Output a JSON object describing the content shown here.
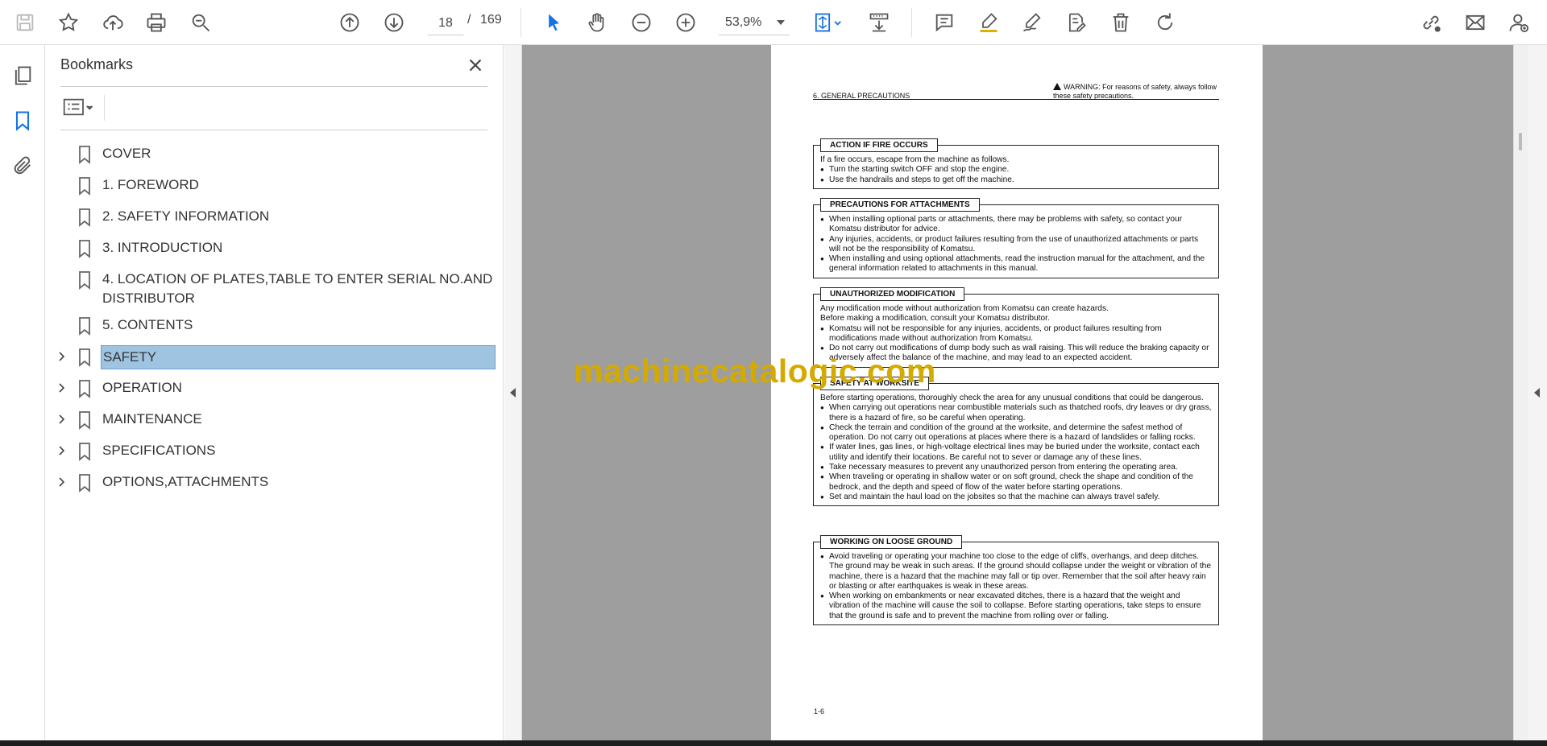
{
  "toolbar": {
    "page_current": "18",
    "page_separator": "/",
    "page_total": "169",
    "zoom": "53,9%",
    "icons": [
      "save-icon",
      "star-icon",
      "cloud-upload-icon",
      "print-icon",
      "zoom-search-icon",
      "page-up-icon",
      "page-down-icon",
      "select-cursor-icon",
      "hand-icon",
      "zoom-out-icon",
      "zoom-in-icon",
      "fit-page-icon",
      "scroll-mode-icon",
      "comment-icon",
      "highlight-icon",
      "sign-icon",
      "edit-text-icon",
      "delete-icon",
      "rotate-icon",
      "share-link-icon",
      "mail-icon",
      "account-icon"
    ]
  },
  "rail": {
    "icons": [
      "pages-icon",
      "bookmark-icon",
      "attachment-icon"
    ]
  },
  "bookmarks": {
    "title": "Bookmarks",
    "items": [
      {
        "label": "COVER",
        "expandable": false,
        "selected": false
      },
      {
        "label": "1. FOREWORD",
        "expandable": false,
        "selected": false
      },
      {
        "label": "2. SAFETY INFORMATION",
        "expandable": false,
        "selected": false
      },
      {
        "label": "3. INTRODUCTION",
        "expandable": false,
        "selected": false
      },
      {
        "label": "4. LOCATION OF PLATES,TABLE TO ENTER SERIAL NO.AND DISTRIBUTOR",
        "expandable": false,
        "selected": false
      },
      {
        "label": "5. CONTENTS",
        "expandable": false,
        "selected": false
      },
      {
        "label": "SAFETY",
        "expandable": true,
        "selected": true
      },
      {
        "label": "OPERATION",
        "expandable": true,
        "selected": false
      },
      {
        "label": "MAINTENANCE",
        "expandable": true,
        "selected": false
      },
      {
        "label": "SPECIFICATIONS",
        "expandable": true,
        "selected": false
      },
      {
        "label": "OPTIONS,ATTACHMENTS",
        "expandable": true,
        "selected": false
      }
    ]
  },
  "document": {
    "header_left": "6.  GENERAL PRECAUTIONS",
    "header_right": "WARNING: For reasons of safety, always follow these safety precautions.",
    "page_number": "1-6",
    "watermark": "machinecatalogic.com",
    "sections": [
      {
        "title": "ACTION IF FIRE OCCURS",
        "intro": [
          "If a fire occurs, escape from the machine as follows."
        ],
        "bullets": [
          "Turn the starting switch OFF and stop the engine.",
          "Use the handrails and steps to get off the machine."
        ]
      },
      {
        "title": "PRECAUTIONS FOR ATTACHMENTS",
        "intro": [],
        "bullets": [
          "When installing optional parts or attachments, there may be problems with safety, so contact your Komatsu distributor for advice.",
          "Any injuries, accidents, or product failures resulting from the use of unauthorized attachments or parts will not be the responsibility of Komatsu.",
          "When installing and using optional attachments, read the instruction manual for the attachment, and the general information related to attachments in this manual."
        ]
      },
      {
        "title": "UNAUTHORIZED MODIFICATION",
        "intro": [
          "Any modification mode without authorization from Komatsu can create hazards.",
          "Before making a modification, consult your Komatsu distributor."
        ],
        "bullets": [
          "Komatsu will not be responsible for any injuries, accidents, or product failures resulting from modifications made without authorization from Komatsu.",
          "Do not carry out modifications of dump body such as wall raising. This will reduce the braking capacity or adversely affect the balance of the machine, and may lead to an expected accident."
        ]
      },
      {
        "title": "SAFETY AT WORKSITE",
        "intro": [
          "Before starting operations, thoroughly check the area for any unusual conditions that could be dangerous."
        ],
        "bullets": [
          "When carrying out operations near combustible materials such as thatched roofs, dry leaves or dry grass, there is a hazard of fire, so be careful when operating.",
          "Check the terrain and condition of the ground at the worksite, and determine the safest method of operation. Do not carry out operations at places where there is a hazard of landslides or falling rocks.",
          "If water lines, gas lines, or high-voltage electrical lines may be buried under the worksite, contact each utility and identify their locations. Be careful not to sever or damage any of these lines.",
          "Take necessary measures to prevent any unauthorized person from entering the operating area.",
          "When traveling or operating in shallow water or on soft ground, check the shape and condition of the bedrock, and the depth and speed of flow of the water before starting operations.",
          "Set and maintain the haul load on the jobsites so that the machine can always travel safely."
        ]
      },
      {
        "title": "WORKING ON LOOSE GROUND",
        "intro": [],
        "bullets": [
          "Avoid traveling or operating your machine too close to the edge of cliffs, overhangs, and deep ditches. The ground may be weak in such areas. If the ground should collapse under the weight or vibration of the machine, there is a hazard that the machine may fall or tip over. Remember that the soil after heavy rain or blasting or after earthquakes is weak in these areas.",
          "When working on embankments or near excavated ditches, there is a hazard that the weight and vibration of the machine will cause the soil to collapse. Before starting operations, take steps to ensure that the ground is safe and to prevent the machine from rolling over or falling."
        ]
      }
    ]
  }
}
